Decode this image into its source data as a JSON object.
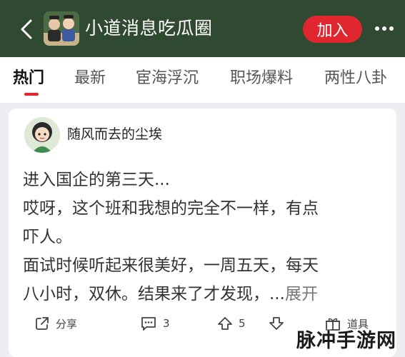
{
  "header": {
    "title": "小道消息吃瓜圈",
    "join_label": "加入",
    "colors": {
      "background": "#2f4a30",
      "join": "#e0262e"
    }
  },
  "tabs": [
    {
      "label": "热门",
      "active": true
    },
    {
      "label": "最新",
      "active": false
    },
    {
      "label": "宦海浮沉",
      "active": false
    },
    {
      "label": "职场爆料",
      "active": false
    },
    {
      "label": "两性八卦",
      "active": false
    }
  ],
  "post": {
    "author": "随风而去的尘埃",
    "lines": [
      "进入国企的第三天...",
      "哎呀，这个班和我想的完全不一样，有点",
      "吓人。",
      "面试时候听起来很美好，一周五天，每天",
      "八小时，双休。结果来了才发现，..."
    ],
    "expand_label": "展开",
    "actions": {
      "share_label": "分享",
      "comment_count": "3",
      "upvote_count": "5",
      "tools_label": "道具"
    }
  },
  "watermark": "脉冲手游网"
}
